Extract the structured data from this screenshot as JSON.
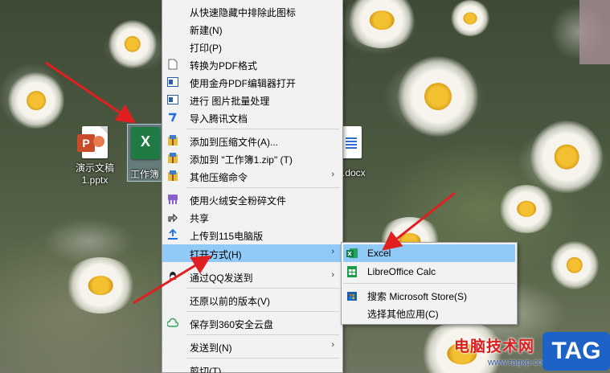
{
  "desktop": {
    "icons": [
      {
        "label_line1": "演示文稿",
        "label_line2": "1.pptx",
        "type_icon": "powerpoint-file-icon"
      },
      {
        "label": "工作簿",
        "type_icon": "excel-file-icon"
      },
      {
        "label": ".docx",
        "type_icon": "word-file-icon"
      }
    ],
    "ppt_badge": "P",
    "xls_badge": "X"
  },
  "context_menu": {
    "items": [
      {
        "label": "从快速隐藏中排除此图标",
        "icon": "none"
      },
      {
        "label": "新建(N)",
        "icon": "none"
      },
      {
        "label": "打印(P)",
        "icon": "none"
      },
      {
        "label": "转换为PDF格式",
        "icon": "pdf-convert-icon"
      },
      {
        "label": "使用金舟PDF编辑器打开",
        "icon": "pdf-editor-icon"
      },
      {
        "label": "进行 图片批量处理",
        "icon": "image-batch-icon"
      },
      {
        "label": "导入腾讯文档",
        "icon": "tencent-docs-icon"
      },
      {
        "label": "添加到压缩文件(A)...",
        "icon": "archive-icon"
      },
      {
        "label": "添加到 \"工作簿1.zip\" (T)",
        "icon": "archive-icon"
      },
      {
        "label": "其他压缩命令",
        "icon": "archive-icon",
        "submenu": true
      },
      {
        "label": "使用火绒安全粉碎文件",
        "icon": "shredder-icon"
      },
      {
        "label": "共享",
        "icon": "share-icon"
      },
      {
        "label": "上传到115电脑版",
        "icon": "upload-115-icon"
      },
      {
        "label": "打开方式(H)",
        "icon": "none",
        "submenu": true,
        "highlighted": true
      },
      {
        "label": "通过QQ发送到",
        "icon": "qq-icon",
        "submenu": true
      },
      {
        "label": "还原以前的版本(V)",
        "icon": "none"
      },
      {
        "label": "保存到360安全云盘",
        "icon": "cloud-360-icon"
      },
      {
        "label": "发送到(N)",
        "icon": "none",
        "submenu": true
      },
      {
        "label": "剪切(T)",
        "icon": "none"
      }
    ],
    "submenu_arrow": "›"
  },
  "open_with_menu": {
    "items": [
      {
        "label": "Excel",
        "icon": "excel-icon",
        "highlighted": true
      },
      {
        "label": "LibreOffice Calc",
        "icon": "libreoffice-calc-icon"
      },
      {
        "label": "搜索 Microsoft Store(S)",
        "icon": "store-icon"
      },
      {
        "label": "选择其他应用(C)",
        "icon": "none"
      }
    ]
  },
  "watermark": {
    "site_name": "电脑技术网",
    "url": "www.tagxp.com",
    "tag": "TAG"
  },
  "colors": {
    "menu_bg": "#f2f2f2",
    "highlight": "#91c9f7",
    "arrow": "#e02020",
    "excel_green": "#1f7a44"
  }
}
